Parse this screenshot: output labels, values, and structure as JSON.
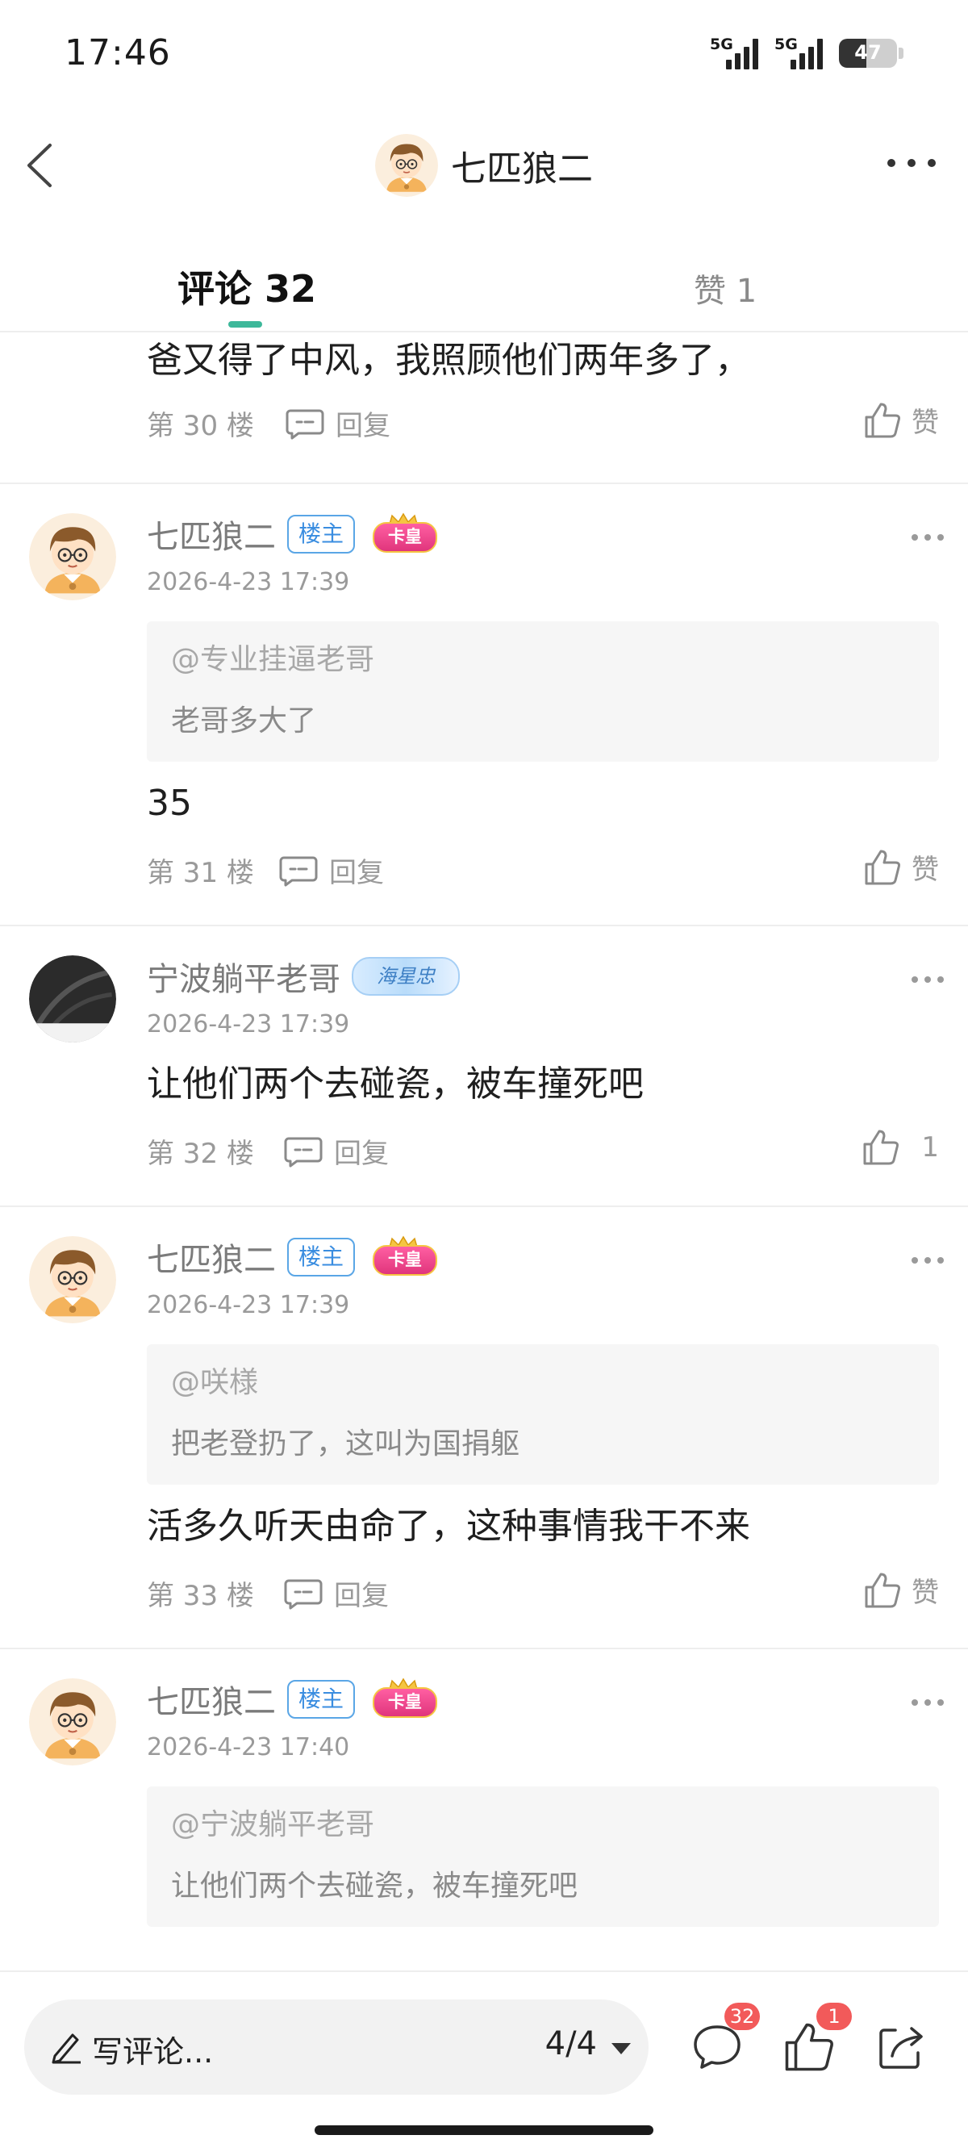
{
  "status_bar": {
    "time": "17:46",
    "signal1": "5G",
    "signal2": "5G",
    "battery": "47",
    "battery_level": 0.47
  },
  "header": {
    "title": "七匹狼二"
  },
  "tabs": {
    "comments": "评论 32",
    "likes": "赞 1"
  },
  "first_comment": {
    "text": "爸又得了中风，我照顾他们两年多了，",
    "floor": "第 30 楼",
    "reply": "回复",
    "like": "赞"
  },
  "comments": [
    {
      "name": "七匹狼二",
      "owner_badge": "楼主",
      "crown_badge": "卡皇",
      "time": "2026-4-23 17:39",
      "quote_user": "@专业挂逼老哥",
      "quote_text": "老哥多大了",
      "text": "35",
      "floor": "第 31 楼",
      "reply": "回复",
      "like": "赞"
    },
    {
      "name": "宁波躺平老哥",
      "gem_badge": "海星忠",
      "time": "2026-4-23 17:39",
      "text": "让他们两个去碰瓷，被车撞死吧",
      "floor": "第 32 楼",
      "reply": "回复",
      "like": "1"
    },
    {
      "name": "七匹狼二",
      "owner_badge": "楼主",
      "crown_badge": "卡皇",
      "time": "2026-4-23 17:39",
      "quote_user": "@咲様",
      "quote_text": "把老登扔了，这叫为国捐躯",
      "text": "活多久听天由命了，这种事情我干不来",
      "floor": "第 33 楼",
      "reply": "回复",
      "like": "赞"
    },
    {
      "name": "七匹狼二",
      "owner_badge": "楼主",
      "crown_badge": "卡皇",
      "time": "2026-4-23 17:40",
      "quote_user": "@宁波躺平老哥",
      "quote_text": "让他们两个去碰瓷，被车撞死吧"
    }
  ],
  "bottom_bar": {
    "write_placeholder": "写评论...",
    "page": "4/4",
    "comment_count": "32",
    "like_count": "1"
  },
  "icons": [
    "back-arrow-icon",
    "more-icon",
    "avatar-boy",
    "reply-icon",
    "thumbs-up-icon",
    "pencil-icon",
    "comment-bubble-icon",
    "share-icon"
  ],
  "colors": {
    "accent": "#3db89a",
    "owner_badge": "#3a8de0",
    "badge_red": "#f25a5a"
  }
}
